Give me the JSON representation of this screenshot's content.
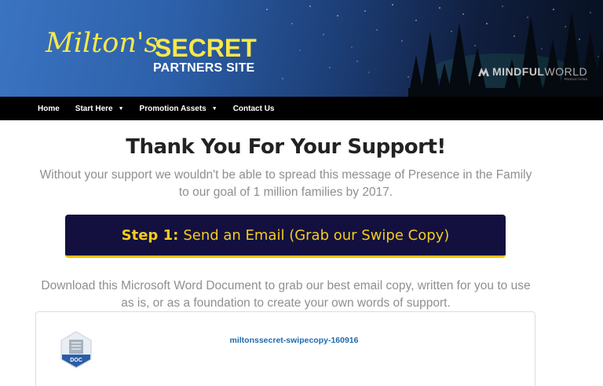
{
  "header": {
    "logo_script": "Milton's",
    "logo_secret": "SECRET",
    "logo_sub": "PARTNERS SITE",
    "partner_logo_bold": "MINDFUL",
    "partner_logo_light": "WORLD",
    "partner_logo_small": "PRODUCTIONS"
  },
  "nav": {
    "items": [
      {
        "label": "Home",
        "dropdown": false
      },
      {
        "label": "Start Here",
        "dropdown": true
      },
      {
        "label": "Promotion Assets",
        "dropdown": true
      },
      {
        "label": "Contact Us",
        "dropdown": false
      }
    ]
  },
  "main": {
    "title": "Thank You For Your Support!",
    "intro": "Without your support we wouldn't be able to spread this message of Presence in the Family to our goal of 1 million families by 2017.",
    "step_button": {
      "prefix": "Step 1:",
      "label": "Send an Email (Grab our Swipe Copy)"
    },
    "download_text": "Download this Microsoft Word Document to grab our best email copy, written for you to use as is, or as a foundation to create your own words of support.",
    "file": {
      "name": "miltonssecret-swipecopy-160916",
      "icon_label": "DOC",
      "icon": "doc-file-icon"
    }
  },
  "colors": {
    "nav_bg": "#000000",
    "accent_yellow": "#f5cc1e",
    "button_bg": "#13103f",
    "link_blue": "#1e6bb0"
  }
}
